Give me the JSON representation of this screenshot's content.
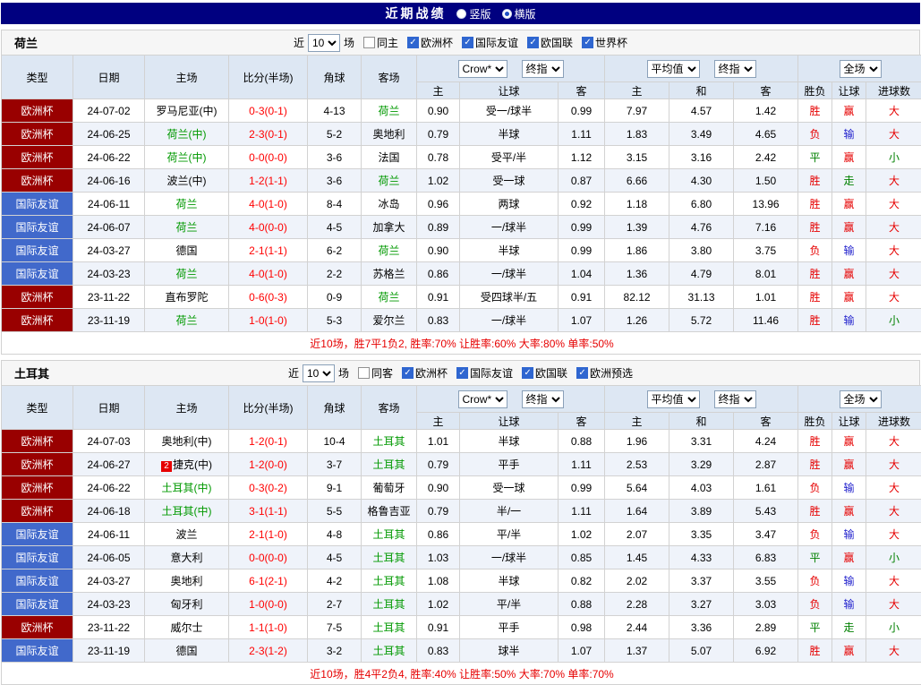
{
  "topbar": {
    "title": "近期战绩",
    "options": [
      {
        "label": "竖版",
        "selected": false
      },
      {
        "label": "横版",
        "selected": true
      }
    ]
  },
  "colors": {
    "score": "#ff0000",
    "team_highlight": "#009900",
    "type_map": {
      "欧洲杯": "#990000",
      "国际友谊": "#4169cb"
    },
    "result_map": {
      "胜": "#e60000",
      "负": "#e60000",
      "平": "#008000",
      "赢": "#e60000",
      "输": "#1e1ecc",
      "走": "#008000",
      "大": "#e60000",
      "小": "#008000"
    }
  },
  "header": {
    "type": "类型",
    "date": "日期",
    "home": "主场",
    "score": "比分(半场)",
    "corners": "角球",
    "away": "客场",
    "asian_select1": "Crow*",
    "asian_select2": "终指",
    "euro_select1": "平均值",
    "euro_select2": "终指",
    "result_select": "全场",
    "asian_home": "主",
    "asian_handicap": "让球",
    "asian_away": "客",
    "euro_home": "主",
    "euro_draw": "和",
    "euro_away": "客",
    "res_wdl": "胜负",
    "res_handicap": "让球",
    "res_goals": "进球数"
  },
  "sections": [
    {
      "team": "荷兰",
      "filter": {
        "near": "近",
        "count": "10",
        "unit": "场",
        "same_label": "同主",
        "same_checked": false,
        "comps": [
          {
            "label": "欧洲杯",
            "checked": true
          },
          {
            "label": "国际友谊",
            "checked": true
          },
          {
            "label": "欧国联",
            "checked": true
          },
          {
            "label": "世界杯",
            "checked": true
          }
        ]
      },
      "rows": [
        {
          "type": "欧洲杯",
          "date": "24-07-02",
          "home": "罗马尼亚(中)",
          "home_hl": false,
          "score": "0-3(0-1)",
          "corners": "4-13",
          "away": "荷兰",
          "away_hl": true,
          "ah": "0.90",
          "hd": "受一/球半",
          "aa": "0.99",
          "eh": "7.97",
          "ed": "4.57",
          "ea": "1.42",
          "r1": "胜",
          "r2": "赢",
          "r3": "大"
        },
        {
          "type": "欧洲杯",
          "date": "24-06-25",
          "home": "荷兰(中)",
          "home_hl": true,
          "score": "2-3(0-1)",
          "corners": "5-2",
          "away": "奥地利",
          "away_hl": false,
          "ah": "0.79",
          "hd": "半球",
          "aa": "1.11",
          "eh": "1.83",
          "ed": "3.49",
          "ea": "4.65",
          "r1": "负",
          "r2": "输",
          "r3": "大"
        },
        {
          "type": "欧洲杯",
          "date": "24-06-22",
          "home": "荷兰(中)",
          "home_hl": true,
          "score": "0-0(0-0)",
          "corners": "3-6",
          "away": "法国",
          "away_hl": false,
          "ah": "0.78",
          "hd": "受平/半",
          "aa": "1.12",
          "eh": "3.15",
          "ed": "3.16",
          "ea": "2.42",
          "r1": "平",
          "r2": "赢",
          "r3": "小"
        },
        {
          "type": "欧洲杯",
          "date": "24-06-16",
          "home": "波兰(中)",
          "home_hl": false,
          "score": "1-2(1-1)",
          "corners": "3-6",
          "away": "荷兰",
          "away_hl": true,
          "ah": "1.02",
          "hd": "受一球",
          "aa": "0.87",
          "eh": "6.66",
          "ed": "4.30",
          "ea": "1.50",
          "r1": "胜",
          "r2": "走",
          "r3": "大"
        },
        {
          "type": "国际友谊",
          "date": "24-06-11",
          "home": "荷兰",
          "home_hl": true,
          "score": "4-0(1-0)",
          "corners": "8-4",
          "away": "冰岛",
          "away_hl": false,
          "ah": "0.96",
          "hd": "两球",
          "aa": "0.92",
          "eh": "1.18",
          "ed": "6.80",
          "ea": "13.96",
          "r1": "胜",
          "r2": "赢",
          "r3": "大"
        },
        {
          "type": "国际友谊",
          "date": "24-06-07",
          "home": "荷兰",
          "home_hl": true,
          "score": "4-0(0-0)",
          "corners": "4-5",
          "away": "加拿大",
          "away_hl": false,
          "ah": "0.89",
          "hd": "一/球半",
          "aa": "0.99",
          "eh": "1.39",
          "ed": "4.76",
          "ea": "7.16",
          "r1": "胜",
          "r2": "赢",
          "r3": "大"
        },
        {
          "type": "国际友谊",
          "date": "24-03-27",
          "home": "德国",
          "home_hl": false,
          "score": "2-1(1-1)",
          "corners": "6-2",
          "away": "荷兰",
          "away_hl": true,
          "ah": "0.90",
          "hd": "半球",
          "aa": "0.99",
          "eh": "1.86",
          "ed": "3.80",
          "ea": "3.75",
          "r1": "负",
          "r2": "输",
          "r3": "大"
        },
        {
          "type": "国际友谊",
          "date": "24-03-23",
          "home": "荷兰",
          "home_hl": true,
          "score": "4-0(1-0)",
          "corners": "2-2",
          "away": "苏格兰",
          "away_hl": false,
          "ah": "0.86",
          "hd": "一/球半",
          "aa": "1.04",
          "eh": "1.36",
          "ed": "4.79",
          "ea": "8.01",
          "r1": "胜",
          "r2": "赢",
          "r3": "大"
        },
        {
          "type": "欧洲杯",
          "date": "23-11-22",
          "home": "直布罗陀",
          "home_hl": false,
          "score": "0-6(0-3)",
          "corners": "0-9",
          "away": "荷兰",
          "away_hl": true,
          "ah": "0.91",
          "hd": "受四球半/五",
          "aa": "0.91",
          "eh": "82.12",
          "ed": "31.13",
          "ea": "1.01",
          "r1": "胜",
          "r2": "赢",
          "r3": "大"
        },
        {
          "type": "欧洲杯",
          "date": "23-11-19",
          "home": "荷兰",
          "home_hl": true,
          "score": "1-0(1-0)",
          "corners": "5-3",
          "away": "爱尔兰",
          "away_hl": false,
          "ah": "0.83",
          "hd": "一/球半",
          "aa": "1.07",
          "eh": "1.26",
          "ed": "5.72",
          "ea": "11.46",
          "r1": "胜",
          "r2": "输",
          "r3": "小"
        }
      ],
      "summary": "近10场，胜7平1负2, 胜率:70% 让胜率:60% 大率:80% 单率:50%"
    },
    {
      "team": "土耳其",
      "filter": {
        "near": "近",
        "count": "10",
        "unit": "场",
        "same_label": "同客",
        "same_checked": false,
        "comps": [
          {
            "label": "欧洲杯",
            "checked": true
          },
          {
            "label": "国际友谊",
            "checked": true
          },
          {
            "label": "欧国联",
            "checked": true
          },
          {
            "label": "欧洲预选",
            "checked": true
          }
        ]
      },
      "rows": [
        {
          "type": "欧洲杯",
          "date": "24-07-03",
          "home": "奥地利(中)",
          "home_hl": false,
          "score": "1-2(0-1)",
          "corners": "10-4",
          "away": "土耳其",
          "away_hl": true,
          "ah": "1.01",
          "hd": "半球",
          "aa": "0.88",
          "eh": "1.96",
          "ed": "3.31",
          "ea": "4.24",
          "r1": "胜",
          "r2": "赢",
          "r3": "大"
        },
        {
          "type": "欧洲杯",
          "date": "24-06-27",
          "home": "捷克(中)",
          "home_hl": false,
          "badge": "2",
          "score": "1-2(0-0)",
          "corners": "3-7",
          "away": "土耳其",
          "away_hl": true,
          "ah": "0.79",
          "hd": "平手",
          "aa": "1.11",
          "eh": "2.53",
          "ed": "3.29",
          "ea": "2.87",
          "r1": "胜",
          "r2": "赢",
          "r3": "大"
        },
        {
          "type": "欧洲杯",
          "date": "24-06-22",
          "home": "土耳其(中)",
          "home_hl": true,
          "score": "0-3(0-2)",
          "corners": "9-1",
          "away": "葡萄牙",
          "away_hl": false,
          "ah": "0.90",
          "hd": "受一球",
          "aa": "0.99",
          "eh": "5.64",
          "ed": "4.03",
          "ea": "1.61",
          "r1": "负",
          "r2": "输",
          "r3": "大"
        },
        {
          "type": "欧洲杯",
          "date": "24-06-18",
          "home": "土耳其(中)",
          "home_hl": true,
          "score": "3-1(1-1)",
          "corners": "5-5",
          "away": "格鲁吉亚",
          "away_hl": false,
          "ah": "0.79",
          "hd": "半/一",
          "aa": "1.11",
          "eh": "1.64",
          "ed": "3.89",
          "ea": "5.43",
          "r1": "胜",
          "r2": "赢",
          "r3": "大"
        },
        {
          "type": "国际友谊",
          "date": "24-06-11",
          "home": "波兰",
          "home_hl": false,
          "score": "2-1(1-0)",
          "corners": "4-8",
          "away": "土耳其",
          "away_hl": true,
          "ah": "0.86",
          "hd": "平/半",
          "aa": "1.02",
          "eh": "2.07",
          "ed": "3.35",
          "ea": "3.47",
          "r1": "负",
          "r2": "输",
          "r3": "大"
        },
        {
          "type": "国际友谊",
          "date": "24-06-05",
          "home": "意大利",
          "home_hl": false,
          "score": "0-0(0-0)",
          "corners": "4-5",
          "away": "土耳其",
          "away_hl": true,
          "ah": "1.03",
          "hd": "一/球半",
          "aa": "0.85",
          "eh": "1.45",
          "ed": "4.33",
          "ea": "6.83",
          "r1": "平",
          "r2": "赢",
          "r3": "小"
        },
        {
          "type": "国际友谊",
          "date": "24-03-27",
          "home": "奥地利",
          "home_hl": false,
          "score": "6-1(2-1)",
          "corners": "4-2",
          "away": "土耳其",
          "away_hl": true,
          "ah": "1.08",
          "hd": "半球",
          "aa": "0.82",
          "eh": "2.02",
          "ed": "3.37",
          "ea": "3.55",
          "r1": "负",
          "r2": "输",
          "r3": "大"
        },
        {
          "type": "国际友谊",
          "date": "24-03-23",
          "home": "匈牙利",
          "home_hl": false,
          "score": "1-0(0-0)",
          "corners": "2-7",
          "away": "土耳其",
          "away_hl": true,
          "ah": "1.02",
          "hd": "平/半",
          "aa": "0.88",
          "eh": "2.28",
          "ed": "3.27",
          "ea": "3.03",
          "r1": "负",
          "r2": "输",
          "r3": "大"
        },
        {
          "type": "欧洲杯",
          "date": "23-11-22",
          "home": "威尔士",
          "home_hl": false,
          "score": "1-1(1-0)",
          "corners": "7-5",
          "away": "土耳其",
          "away_hl": true,
          "ah": "0.91",
          "hd": "平手",
          "aa": "0.98",
          "eh": "2.44",
          "ed": "3.36",
          "ea": "2.89",
          "r1": "平",
          "r2": "走",
          "r3": "小"
        },
        {
          "type": "国际友谊",
          "date": "23-11-19",
          "home": "德国",
          "home_hl": false,
          "score": "2-3(1-2)",
          "corners": "3-2",
          "away": "土耳其",
          "away_hl": true,
          "ah": "0.83",
          "hd": "球半",
          "aa": "1.07",
          "eh": "1.37",
          "ed": "5.07",
          "ea": "6.92",
          "r1": "胜",
          "r2": "赢",
          "r3": "大"
        }
      ],
      "summary": "近10场，胜4平2负4, 胜率:40% 让胜率:50% 大率:70% 单率:70%"
    }
  ]
}
